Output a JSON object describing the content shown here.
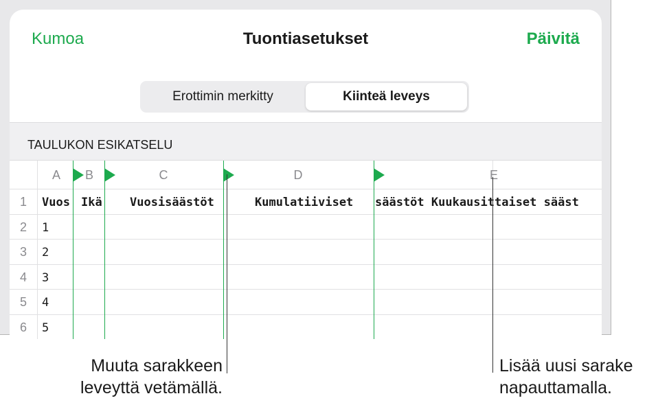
{
  "nav": {
    "cancel": "Kumoa",
    "title": "Tuontiasetukset",
    "update": "Päivitä"
  },
  "segmented": {
    "options": [
      "Erottimin merkitty",
      "Kiinteä leveys"
    ],
    "selected": "Kiinteä leveys"
  },
  "section_header": "TAULUKON ESIKATSELU",
  "columns": [
    "A",
    "B",
    "C",
    "D",
    "E"
  ],
  "rows": [
    "1",
    "2",
    "3",
    "4",
    "5",
    "6"
  ],
  "header_cells": {
    "a": "Vuos",
    "b": "Ikä",
    "c": "Vuosisäästöt",
    "d": "Kumulatiiviset",
    "e": "säästöt Kuukausittaiset sääst"
  },
  "col_a_values": [
    "1",
    "2",
    "3",
    "4",
    "5"
  ],
  "callouts": {
    "left_line1": "Muuta sarakkeen",
    "left_line2": "leveyttä vetämällä.",
    "right_line1": "Lisää uusi sarake",
    "right_line2": "napauttamalla."
  },
  "colors": {
    "accent": "#1daa4e",
    "background": "#e8e8ea"
  }
}
